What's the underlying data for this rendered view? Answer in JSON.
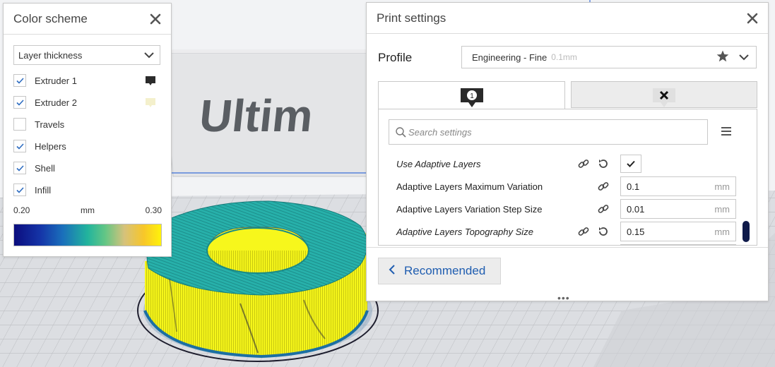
{
  "viewport": {
    "brand_text": "Ultim",
    "colors": {
      "model_yellow": "#f3f315",
      "model_teal": "#23a7a7",
      "plate": "#dadce0",
      "grid": "#b5b7bb",
      "backwall": "#e3e4e6"
    }
  },
  "color_scheme": {
    "title": "Color scheme",
    "mode": "Layer thickness",
    "items": [
      {
        "label": "Extruder 1",
        "checked": true,
        "swatch": "#2b2b2b"
      },
      {
        "label": "Extruder 2",
        "checked": true,
        "swatch": "#f4f0cc"
      },
      {
        "label": "Travels",
        "checked": false
      },
      {
        "label": "Helpers",
        "checked": true
      },
      {
        "label": "Shell",
        "checked": true
      },
      {
        "label": "Infill",
        "checked": true
      }
    ],
    "gradient": {
      "min": "0.20",
      "unit": "mm",
      "max": "0.30"
    }
  },
  "print_settings": {
    "title": "Print settings",
    "profile_label": "Profile",
    "profile_name": "Engineering - Fine",
    "profile_layer": "0.1mm",
    "tabs": [
      {
        "badge": "1",
        "icon": "extruder-icon"
      },
      {
        "badge": "",
        "icon": "disabled-extruder-icon"
      }
    ],
    "search_placeholder": "Search settings",
    "settings": [
      {
        "name": "Use Adaptive Layers",
        "value": "",
        "unit": "",
        "italic": true,
        "checked": true
      },
      {
        "name": "Adaptive Layers Maximum Variation",
        "value": "0.1",
        "unit": "mm",
        "italic": false
      },
      {
        "name": "Adaptive Layers Variation Step Size",
        "value": "0.01",
        "unit": "mm",
        "italic": false
      },
      {
        "name": "Adaptive Layers Topography Size",
        "value": "0.15",
        "unit": "mm",
        "italic": true
      }
    ],
    "recommended_label": "Recommended",
    "accent": "#1f5db0"
  }
}
